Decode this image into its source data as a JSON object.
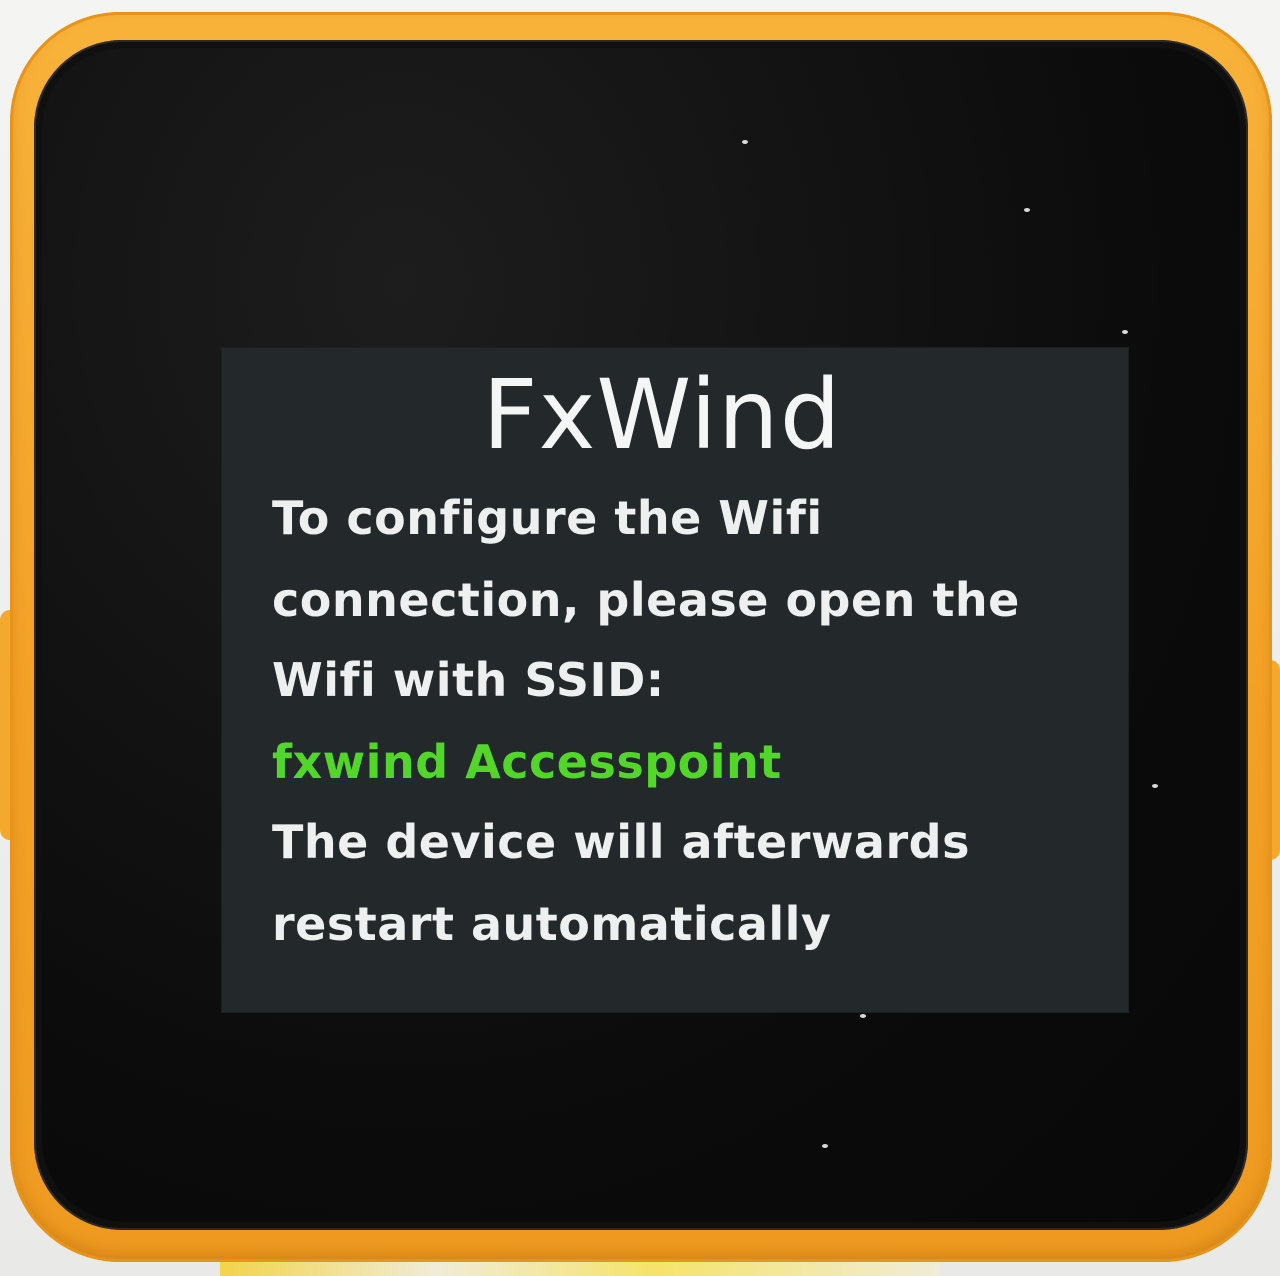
{
  "device": {
    "case_color": "#f3a126",
    "bezel_color": "#101010",
    "screen_background": "#23282a"
  },
  "screen": {
    "title": "FxWind",
    "lines": [
      "To configure the Wifi",
      "connection, please open the",
      "Wifi with SSID:",
      "fxwind Accesspoint",
      "The device will afterwards",
      "restart automatically"
    ],
    "ssid_color": "#52d62a",
    "text_color": "#eef0f0"
  }
}
